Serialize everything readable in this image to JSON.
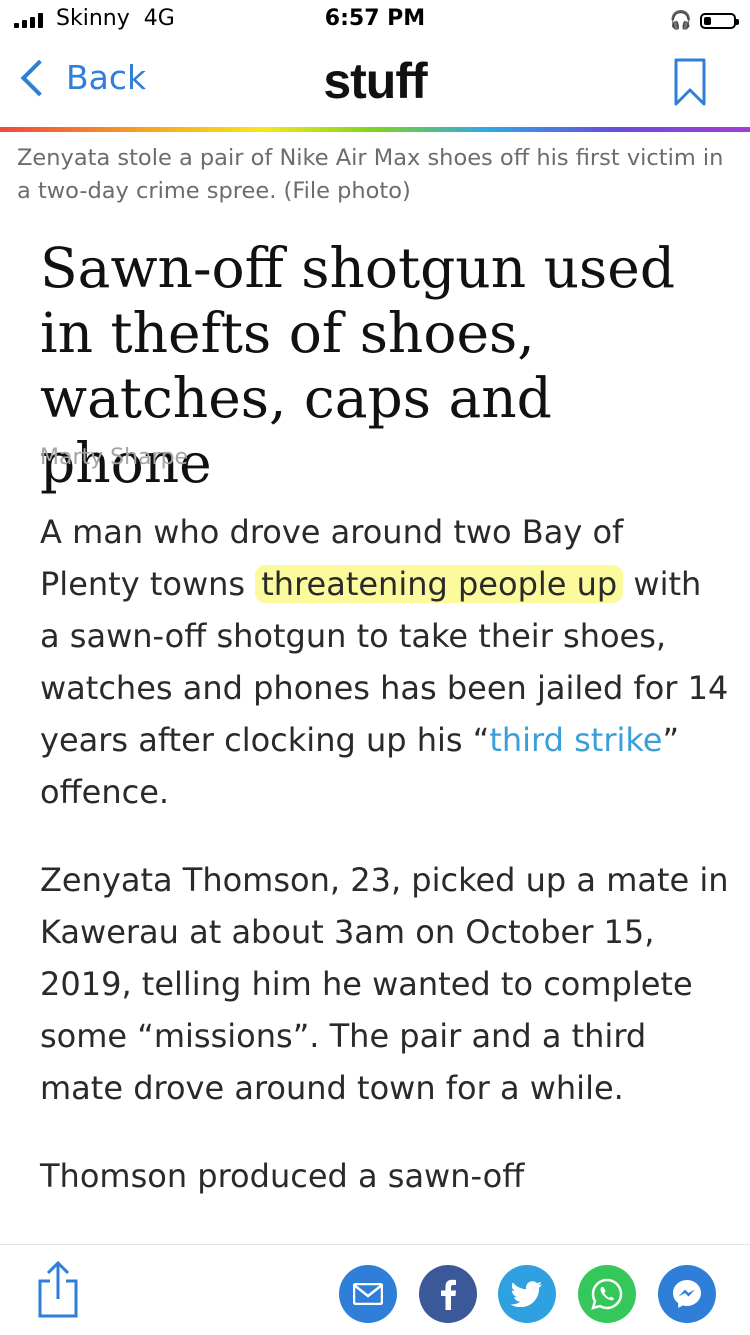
{
  "status_bar": {
    "carrier": "Skinny",
    "network": "4G",
    "time": "6:57 PM",
    "battery_level": 0.25
  },
  "nav": {
    "back_label": "Back",
    "brand": "stuff",
    "bookmark_icon": "bookmark-icon"
  },
  "article": {
    "photo_caption": "Zenyata stole a pair of Nike Air Max shoes off his first victim in a two-day crime spree. (File photo)",
    "headline": "Sawn-off shotgun used in thefts of shoes, watches, caps and phone",
    "byline": "Marty Sharpe",
    "p1_before": "A man who drove around two Bay of Plenty towns ",
    "p1_highlight": "threatening people up",
    "p1_mid": " with a sawn-off shotgun to take their shoes, watches and phones has been jailed for 14 years after clocking up his “",
    "p1_link": "third strike",
    "p1_after": "” offence.",
    "p2": "Zenyata Thomson, 23, picked up a mate in Kawerau at about 3am on October 15, 2019, telling him he wanted to complete some “missions”. The pair and a third mate drove around town for a while.",
    "p3": "Thomson produced a sawn-off"
  },
  "colors": {
    "accent": "#2f7fd8",
    "link": "#3a9fd8",
    "highlight": "#fbfb9e",
    "facebook": "#3b5998",
    "twitter": "#2fa1e0",
    "whatsapp": "#35c759"
  },
  "toolbar": {
    "icons": [
      "share-icon",
      "email-icon",
      "facebook-icon",
      "twitter-icon",
      "whatsapp-icon",
      "messenger-icon"
    ]
  }
}
